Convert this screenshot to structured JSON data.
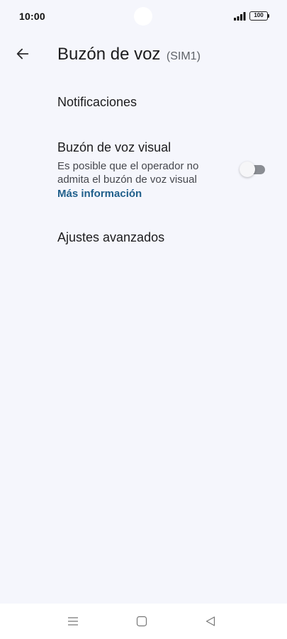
{
  "status_bar": {
    "time": "10:00",
    "battery": "100"
  },
  "header": {
    "title": "Buzón de voz",
    "subtitle": "(SIM1)"
  },
  "settings": {
    "notifications": {
      "label": "Notificaciones"
    },
    "visual_voicemail": {
      "label": "Buzón de voz visual",
      "summary": "Es posible que el operador no admita el buzón de voz visual",
      "link": "Más información",
      "enabled": false
    },
    "advanced": {
      "label": "Ajustes avanzados"
    }
  },
  "colors": {
    "background": "#f5f6fc",
    "link": "#1f5f8b",
    "toggle_off_track": "#8a8d93"
  },
  "icons": {
    "back": "arrow-back-icon",
    "signal": "cellular-signal-icon",
    "battery": "battery-icon",
    "nav_menu": "menu-lines-icon",
    "nav_home": "square-home-icon",
    "nav_back": "triangle-back-icon"
  }
}
